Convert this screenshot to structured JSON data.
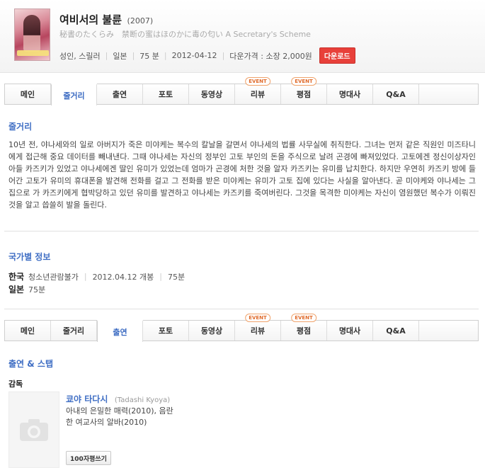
{
  "movie": {
    "title": "여비서의 불륜",
    "year": "(2007)",
    "original_title": "秘書のたくらみ　禁断の蜜はほのかに毒の匂い A Secretary's Scheme",
    "genre": "성인, 스릴러",
    "country": "일본",
    "runtime": "75 분",
    "date": "2012-04-12",
    "price": "다운가격 : 소장 2,000원",
    "download_label": "다운로드"
  },
  "tabs": [
    {
      "label": "메인"
    },
    {
      "label": "줄거리"
    },
    {
      "label": "출연"
    },
    {
      "label": "포토"
    },
    {
      "label": "동영상"
    },
    {
      "label": "리뷰",
      "badge": "EVENT"
    },
    {
      "label": "평점",
      "badge": "EVENT"
    },
    {
      "label": "명대사"
    },
    {
      "label": "Q&A"
    }
  ],
  "synopsis": {
    "heading": "줄거리",
    "text": "10년 전, 야나세와의 일로 아버지가 죽은 미야케는 복수의 칼날을 갈면서 야나세의 법률 사무실에 취직한다. 그녀는 먼저 같은 직원인 미즈타니에게 접근해 중요 데이터를 빼내낸다. 그때 야나세는 자신의 정부인 고토 부인의 돈을 주식으로 날려 곤경에 빠져있었다. 고토에겐 정신이상자인 아들 카즈키가 있었고 야나세에겐 딸인 유미가 있었는데 엄마가 곤경에 처한 것을 알자 카즈키는 유미를 납치한다. 하지만 우연히 카즈키 방에 들어간 고토가 유미의 휴대폰을 발견해 전화를 걸고 그 전화를 받은 미야케는 유미가 고토 집에 있다는 사실을 알아낸다. 곧 미야케와 야나세는 그 집으로 가 카즈키에게 협박당하고 있던 유미를 발견하고 야나세는 카즈키를 죽여버린다. 그것을 목격한 미야케는 자신이 염원했던 복수가 이뤄진 것을 알고 씁쓸히 발을 돌린다."
  },
  "country_info": {
    "heading": "국가별 정보",
    "rows": [
      {
        "country": "한국",
        "rating": "청소년관람불가",
        "release": "2012.04.12 개봉",
        "runtime": "75분"
      },
      {
        "country": "일본",
        "runtime": "75분"
      }
    ]
  },
  "cast": {
    "heading": "출연 & 스탭",
    "director_label": "감독",
    "director": {
      "name_kr": "쿄야 타다시",
      "name_en": "(Tadashi Kyoya)",
      "works": "아내의 은밀한 매력(2010), 음란한 여교사의 알바(2010)"
    },
    "review_button": "100자평쓰기"
  },
  "colors": {
    "accent": "#3f6ec4",
    "download": "#e8403a",
    "event": "#e06a2a"
  }
}
